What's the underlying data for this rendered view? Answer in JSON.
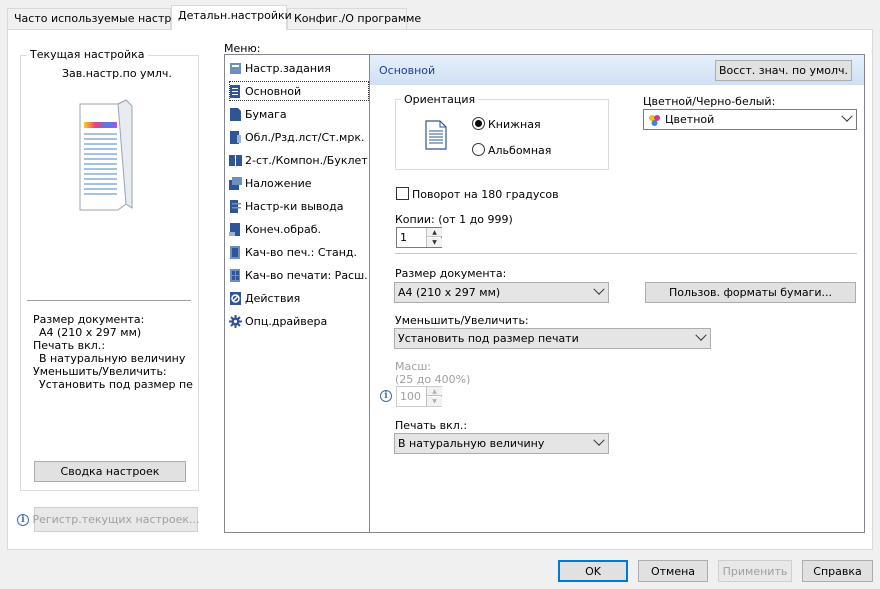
{
  "tabs": [
    {
      "label": "Часто используемые настр-ки"
    },
    {
      "label": "Детальн.настройки"
    },
    {
      "label": "Конфиг./О программе"
    }
  ],
  "current": {
    "legend": "Текущая настройка",
    "profile": "Зав.настр.по умлч.",
    "doc_size_label": "Размер документа:",
    "doc_size_value": "A4 (210 x 297 мм)",
    "print_on_label": "Печать вкл.:",
    "print_on_value": "В натуральную величину",
    "zoom_label": "Уменьшить/Увеличить:",
    "zoom_value": "Установить под размер печат",
    "summary_button": "Сводка настроек",
    "register_button": "Регистр.текущих настроек..."
  },
  "menu": {
    "label": "Меню:",
    "items": [
      {
        "label": "Настр.задания",
        "icon": "job-settings-icon"
      },
      {
        "label": "Основной",
        "icon": "basic-icon"
      },
      {
        "label": "Бумага",
        "icon": "paper-icon"
      },
      {
        "label": "Обл./Рзд.лст/Ст.мрк.",
        "icon": "cover-icon"
      },
      {
        "label": "2-ст./Компон./Буклет",
        "icon": "duplex-icon"
      },
      {
        "label": "Наложение",
        "icon": "overlay-icon"
      },
      {
        "label": "Настр-ки вывода",
        "icon": "output-icon"
      },
      {
        "label": "Конеч.обраб.",
        "icon": "finishing-icon"
      },
      {
        "label": "Кач-во печ.: Станд.",
        "icon": "quality-standard-icon"
      },
      {
        "label": "Кач-во печати: Расш.",
        "icon": "quality-advanced-icon"
      },
      {
        "label": "Действия",
        "icon": "actions-icon"
      },
      {
        "label": "Опц.драйвера",
        "icon": "driver-options-icon"
      }
    ]
  },
  "pane": {
    "title": "Основной",
    "restore_button": "Восст. знач. по умолч.",
    "orientation": {
      "legend": "Ориентация",
      "portrait": "Книжная",
      "landscape": "Альбомная",
      "selected": "portrait"
    },
    "color": {
      "label": "Цветной/Черно-белый:",
      "value": "Цветной"
    },
    "rotate180": {
      "label": "Поворот на 180 градусов",
      "checked": false
    },
    "copies": {
      "label": "Копии: (от 1 до 999)",
      "value": "1"
    },
    "doc_size": {
      "label": "Размер документа:",
      "value": "A4 (210 x 297 мм)"
    },
    "custom_paper_button": "Пользов. форматы бумаги...",
    "zoom": {
      "label": "Уменьшить/Увеличить:",
      "value": "Установить под размер печати"
    },
    "scale": {
      "label": "Масш:",
      "range": "(25 до 400%)",
      "value": "100"
    },
    "print_on": {
      "label": "Печать вкл.:",
      "value": "В натуральную величину"
    }
  },
  "buttons": {
    "ok": "OK",
    "cancel": "Отмена",
    "apply": "Применить",
    "help": "Справка"
  },
  "colors": {
    "accent": "#0078d7",
    "header_text": "#1c3f94"
  }
}
